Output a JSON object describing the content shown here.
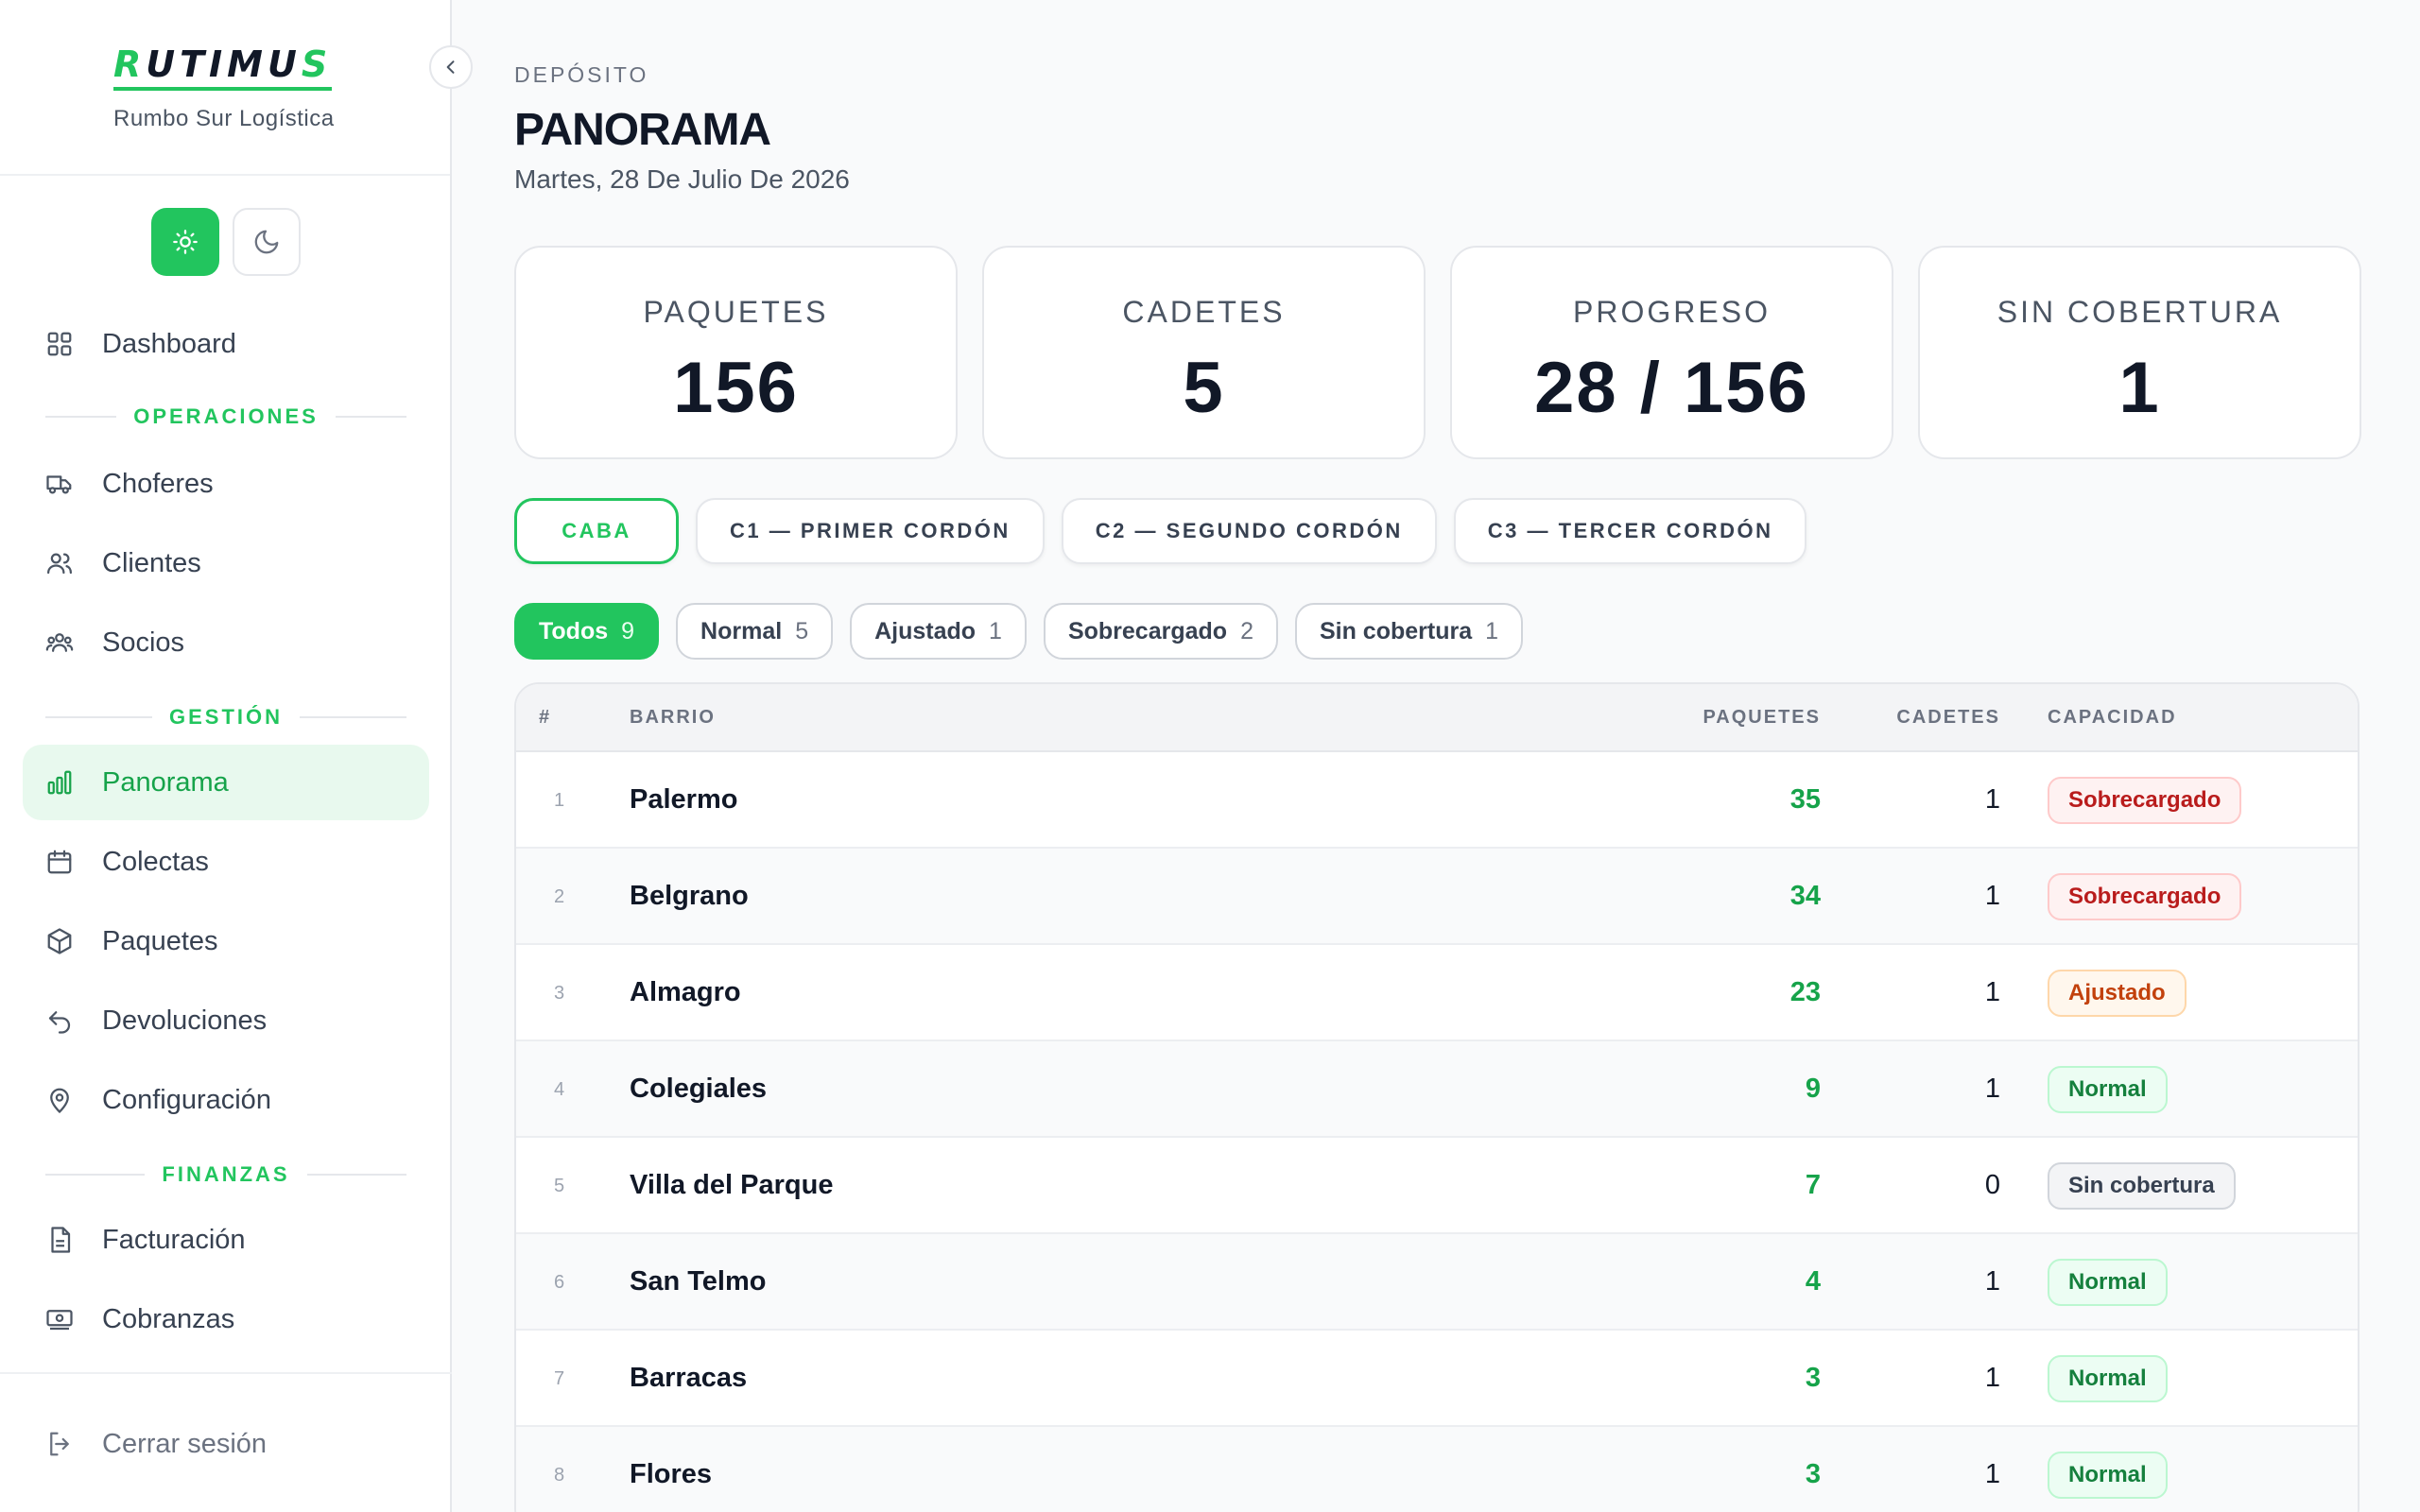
{
  "brand": {
    "logo_r": "R",
    "logo_mid": "UTIMU",
    "logo_s": "S",
    "subtitle": "Rumbo Sur Logística"
  },
  "nav": {
    "dashboard": "Dashboard",
    "sections": {
      "operaciones": "OPERACIONES",
      "gestion": "GESTIÓN",
      "finanzas": "FINANZAS"
    },
    "choferes": "Choferes",
    "clientes": "Clientes",
    "socios": "Socios",
    "panorama": "Panorama",
    "colectas": "Colectas",
    "paquetes": "Paquetes",
    "devoluciones": "Devoluciones",
    "configuracion": "Configuración",
    "facturacion": "Facturación",
    "cobranzas": "Cobranzas",
    "logout": "Cerrar sesión"
  },
  "header": {
    "kicker": "DEPÓSITO",
    "title": "PANORAMA",
    "date": "Martes, 28 De Julio De 2026"
  },
  "stats": [
    {
      "label": "PAQUETES",
      "value": "156"
    },
    {
      "label": "CADETES",
      "value": "5"
    },
    {
      "label": "PROGRESO",
      "value": "28 / 156"
    },
    {
      "label": "SIN COBERTURA",
      "value": "1"
    }
  ],
  "zones": [
    "CABA",
    "C1 — PRIMER CORDÓN",
    "C2 — SEGUNDO CORDÓN",
    "C3 — TERCER CORDÓN"
  ],
  "filters": [
    {
      "label": "Todos",
      "count": "9"
    },
    {
      "label": "Normal",
      "count": "5"
    },
    {
      "label": "Ajustado",
      "count": "1"
    },
    {
      "label": "Sobrecargado",
      "count": "2"
    },
    {
      "label": "Sin cobertura",
      "count": "1"
    }
  ],
  "table": {
    "headers": {
      "num": "#",
      "barrio": "BARRIO",
      "paquetes": "PAQUETES",
      "cadetes": "CADETES",
      "capacidad": "CAPACIDAD"
    },
    "rows": [
      {
        "num": "1",
        "barrio": "Palermo",
        "paquetes": "35",
        "cadetes": "1",
        "capacidad": "Sobrecargado"
      },
      {
        "num": "2",
        "barrio": "Belgrano",
        "paquetes": "34",
        "cadetes": "1",
        "capacidad": "Sobrecargado"
      },
      {
        "num": "3",
        "barrio": "Almagro",
        "paquetes": "23",
        "cadetes": "1",
        "capacidad": "Ajustado"
      },
      {
        "num": "4",
        "barrio": "Colegiales",
        "paquetes": "9",
        "cadetes": "1",
        "capacidad": "Normal"
      },
      {
        "num": "5",
        "barrio": "Villa del Parque",
        "paquetes": "7",
        "cadetes": "0",
        "capacidad": "Sin cobertura"
      },
      {
        "num": "6",
        "barrio": "San Telmo",
        "paquetes": "4",
        "cadetes": "1",
        "capacidad": "Normal"
      },
      {
        "num": "7",
        "barrio": "Barracas",
        "paquetes": "3",
        "cadetes": "1",
        "capacidad": "Normal"
      },
      {
        "num": "8",
        "barrio": "Flores",
        "paquetes": "3",
        "cadetes": "1",
        "capacidad": "Normal"
      }
    ]
  },
  "colors": {
    "accent": "#22c55e",
    "accent_dark": "#16a34a",
    "danger": "#b91c1c",
    "warning": "#c2410c"
  }
}
